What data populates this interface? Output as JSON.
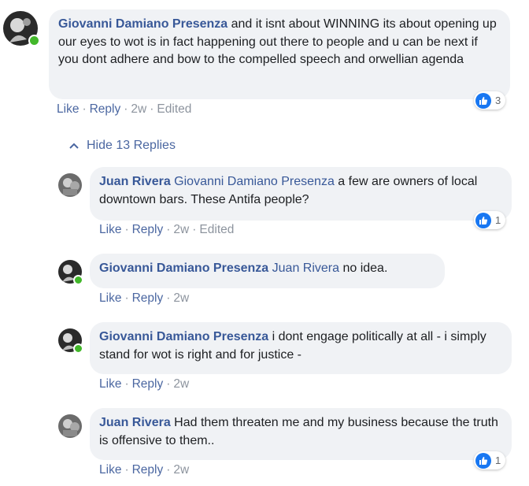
{
  "comments": [
    {
      "author": "Giovanni Damiano Presenza",
      "text": " and it isnt about WINNING its about opening up our eyes to wot is in fact happening out there to people and u can be next if you dont adhere and bow to the compelled speech and orwellian agenda",
      "actions": {
        "like": "Like",
        "reply": "Reply",
        "time": "2w",
        "edited": "Edited"
      },
      "reactions": "3",
      "online": true
    }
  ],
  "hide_replies": "Hide 13 Replies",
  "replies": [
    {
      "author": "Juan Rivera",
      "mention": "Giovanni Damiano Presenza",
      "text": " a few are owners of local downtown bars. These Antifa people?",
      "actions": {
        "like": "Like",
        "reply": "Reply",
        "time": "2w",
        "edited": "Edited"
      },
      "reactions": "1"
    },
    {
      "author": "Giovanni Damiano Presenza",
      "mention": "Juan Rivera",
      "text": " no idea.",
      "actions": {
        "like": "Like",
        "reply": "Reply",
        "time": "2w"
      },
      "online": true
    },
    {
      "author": "Giovanni Damiano Presenza",
      "text": " i dont engage politically at all - i simply stand for wot is right and for justice -",
      "actions": {
        "like": "Like",
        "reply": "Reply",
        "time": "2w"
      },
      "online": true
    },
    {
      "author": "Juan Rivera",
      "text": " Had them threaten me and my business because the truth is offensive to them..",
      "actions": {
        "like": "Like",
        "reply": "Reply",
        "time": "2w"
      },
      "reactions": "1"
    }
  ],
  "separator": "·",
  "icons": {
    "like": "thumbs-up-icon",
    "chevron": "chevron-up-icon"
  },
  "colors": {
    "link": "#385898",
    "bubble": "#f0f2f5",
    "like_blue": "#1877f2",
    "online": "#42b72a"
  }
}
